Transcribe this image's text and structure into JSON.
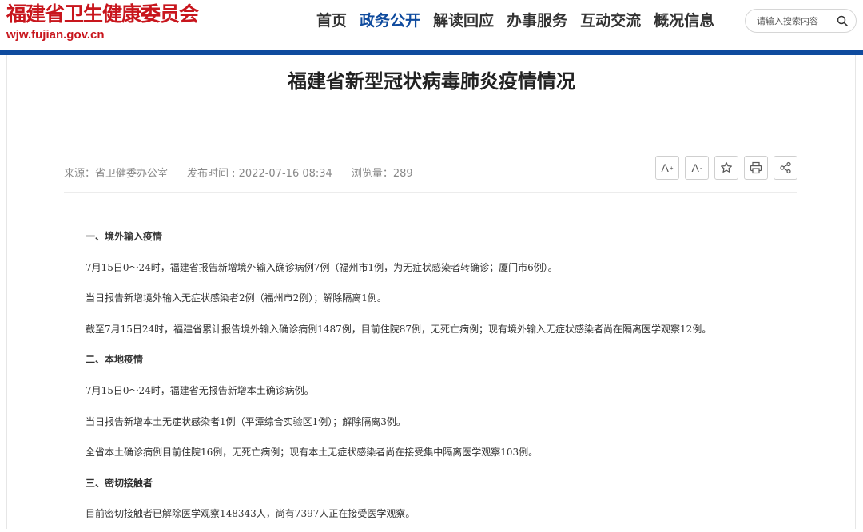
{
  "header": {
    "site_title": "福建省卫生健康委员会",
    "site_url": "wjw.fujian.gov.cn",
    "nav": [
      {
        "label": "首页",
        "active": false
      },
      {
        "label": "政务公开",
        "active": true
      },
      {
        "label": "解读回应",
        "active": false
      },
      {
        "label": "办事服务",
        "active": false
      },
      {
        "label": "互动交流",
        "active": false
      },
      {
        "label": "概况信息",
        "active": false
      }
    ],
    "search": {
      "placeholder": "请输入搜索内容",
      "value": "",
      "icon": "search-icon"
    },
    "accent_color": "#0f4b9e",
    "brand_color": "#c8161d"
  },
  "article": {
    "title": "福建省新型冠状病毒肺炎疫情情况",
    "meta": {
      "source": "来源：省卫健委办公室",
      "published": "发布时间 : 2022-07-16 08:34",
      "views": "浏览量：289"
    },
    "tools": [
      {
        "name": "font-increase",
        "label": "A",
        "sup": "+"
      },
      {
        "name": "font-decrease",
        "label": "A",
        "sup": "-"
      },
      {
        "name": "favorite",
        "icon": "star-icon"
      },
      {
        "name": "print",
        "icon": "print-icon"
      },
      {
        "name": "share",
        "icon": "share-icon"
      }
    ],
    "paragraphs": [
      {
        "text": "一、境外输入疫情",
        "heading": true
      },
      {
        "text": "7月15日0～24时，福建省报告新增境外输入确诊病例7例（福州市1例，为无症状感染者转确诊；厦门市6例）。",
        "heading": false
      },
      {
        "text": "当日报告新增境外输入无症状感染者2例（福州市2例）；解除隔离1例。",
        "heading": false
      },
      {
        "text": "截至7月15日24时，福建省累计报告境外输入确诊病例1487例，目前住院87例，无死亡病例；现有境外输入无症状感染者尚在隔离医学观察12例。",
        "heading": false
      },
      {
        "text": "二、本地疫情",
        "heading": true
      },
      {
        "text": "7月15日0～24时，福建省无报告新增本土确诊病例。",
        "heading": false
      },
      {
        "text": "当日报告新增本土无症状感染者1例（平潭综合实验区1例）；解除隔离3例。",
        "heading": false
      },
      {
        "text": "全省本土确诊病例目前住院16例，无死亡病例；现有本土无症状感染者尚在接受集中隔离医学观察103例。",
        "heading": false
      },
      {
        "text": "三、密切接触者",
        "heading": true
      },
      {
        "text": "目前密切接触者已解除医学观察148343人，尚有7397人正在接受医学观察。",
        "heading": false
      }
    ]
  }
}
